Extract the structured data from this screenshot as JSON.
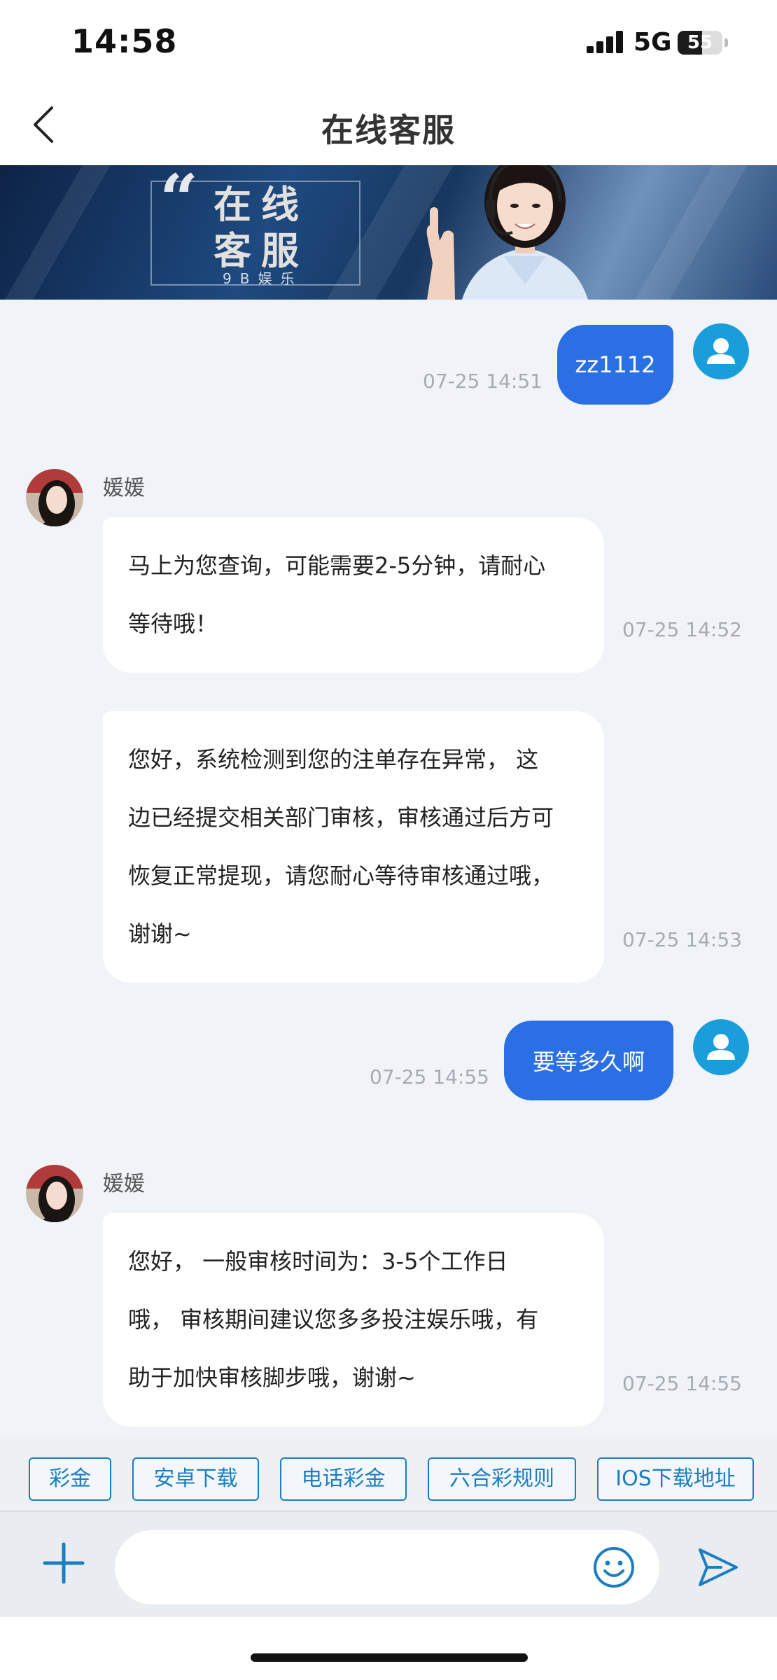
{
  "status_bar": {
    "time": "14:58",
    "network": "5G",
    "battery": "55",
    "battery_level": 0.55
  },
  "nav": {
    "title": "在线客服",
    "back_icon": "chevron-left-icon"
  },
  "banner": {
    "line1": "在线",
    "line2": "客服",
    "subtitle": "9B娱乐"
  },
  "messages": [
    {
      "sender": "user",
      "text": "zz1112",
      "time": "07-25 14:51"
    },
    {
      "sender": "agent",
      "name": "媛媛",
      "lines": [
        "马上为您查询，可能需要2-5分钟，请耐心",
        "等待哦！"
      ],
      "time": "07-25 14:52"
    },
    {
      "sender": "agent",
      "lines": [
        "您好，系统检测到您的注单存在异常， 这",
        "边已经提交相关部门审核，审核通过后方可",
        "恢复正常提现，请您耐心等待审核通过哦，",
        "谢谢~"
      ],
      "time": "07-25 14:53"
    },
    {
      "sender": "user",
      "text": "要等多久啊",
      "time": "07-25 14:55"
    },
    {
      "sender": "agent",
      "name": "媛媛",
      "lines": [
        "您好， 一般审核时间为：3-5个工作日",
        "哦， 审核期间建议您多多投注娱乐哦，有",
        "助于加快审核脚步哦，谢谢~"
      ],
      "time": "07-25 14:55"
    }
  ],
  "quick_replies": [
    "彩金",
    "安卓下载",
    "电话彩金",
    "六合彩规则",
    "IOS下载地址"
  ],
  "input": {
    "placeholder": ""
  },
  "colors": {
    "user_bubble": "#2a6fe3",
    "accent": "#1b7ec2",
    "avatar": "#1a9edb"
  }
}
